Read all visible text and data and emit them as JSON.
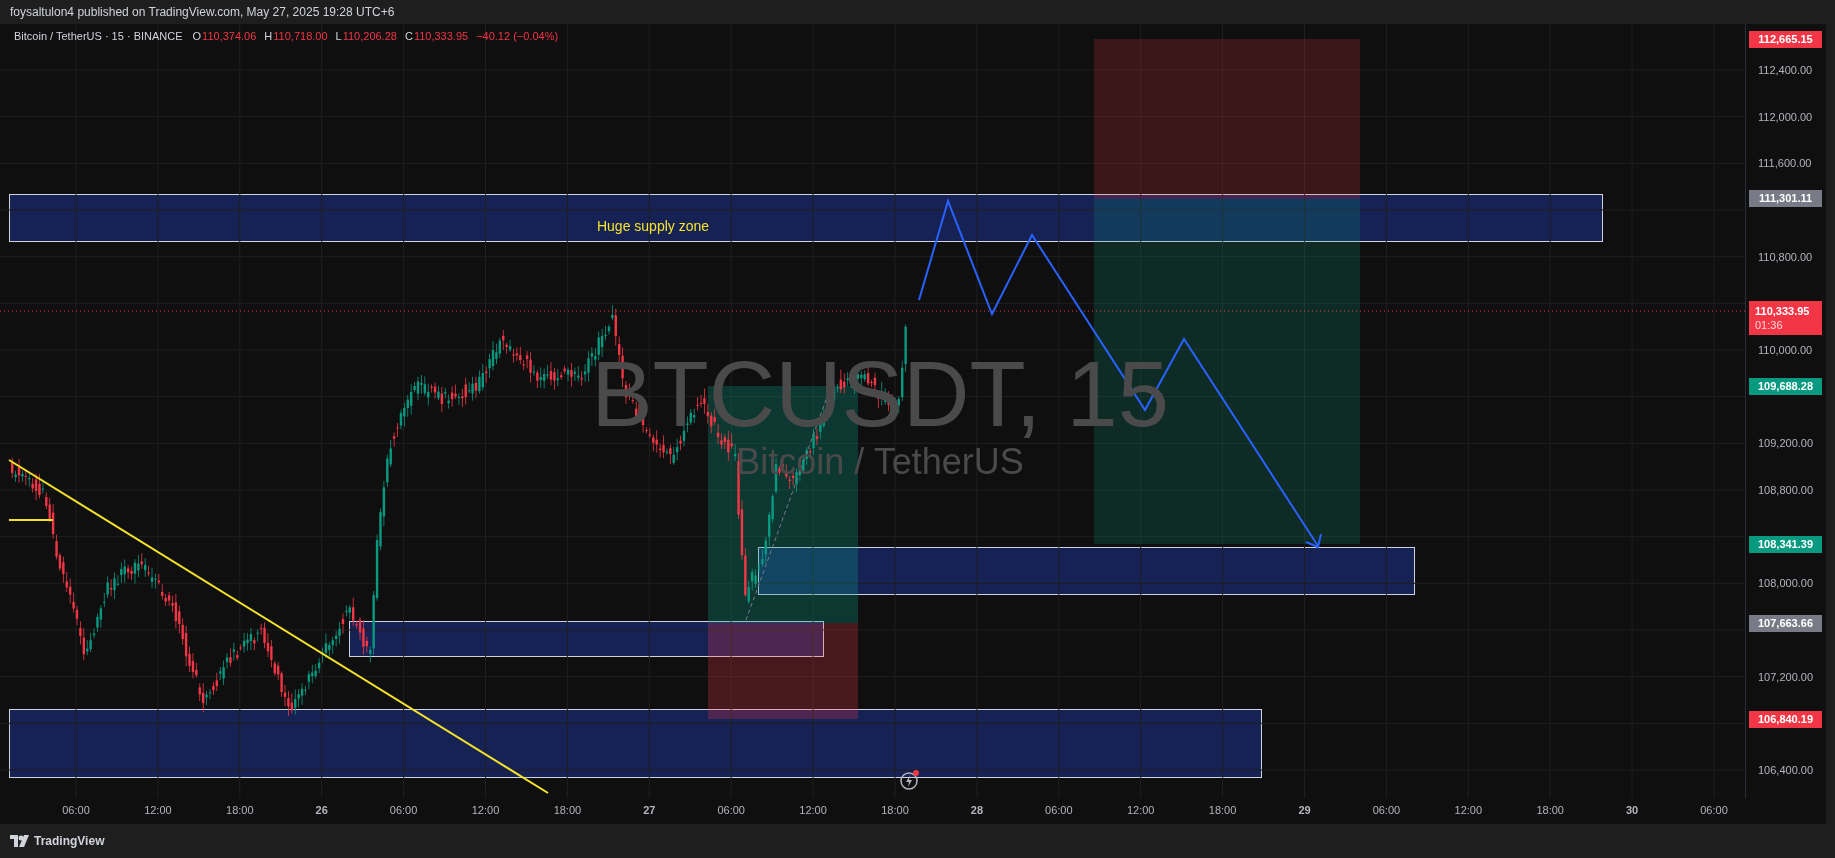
{
  "header": {
    "publisher": "foysaltulon4 published on TradingView.com, May 27, 2025 19:28 UTC+6"
  },
  "legend": {
    "symbol": "Bitcoin / TetherUS · 15 · BINANCE",
    "values": [
      {
        "label": "O",
        "value": "110,374.06"
      },
      {
        "label": "H",
        "value": "110,718.00"
      },
      {
        "label": "L",
        "value": "110,206.28"
      },
      {
        "label": "C",
        "value": "110,333.95"
      }
    ],
    "change": "−40.12 (−0.04%)"
  },
  "symbol_watermark": {
    "ticker": "BTCUSDT, 15",
    "name": "Bitcoin / TetherUS"
  },
  "annotation": {
    "text": "Huge supply zone"
  },
  "price_axis": {
    "ticks": [
      "112,400.00",
      "112,000.00",
      "111,600.00",
      "110,800.00",
      "110,000.00",
      "109,200.00",
      "108,800.00",
      "108,000.00",
      "107,200.00",
      "106,400.00"
    ],
    "labels": [
      {
        "text": "112,665.15",
        "kind": "stop"
      },
      {
        "text": "111,301.11",
        "kind": "entry"
      },
      {
        "text": "109,688.28",
        "kind": "target"
      },
      {
        "text": "108,341.39",
        "kind": "target"
      },
      {
        "text": "107,663.66",
        "kind": "entry"
      },
      {
        "text": "106,840.19",
        "kind": "stop"
      }
    ]
  },
  "current_price": {
    "price": "110,333.95",
    "countdown": "01:36"
  },
  "time_axis": {
    "labels": [
      {
        "text": "06:00",
        "kind": "time"
      },
      {
        "text": "12:00",
        "kind": "time"
      },
      {
        "text": "18:00",
        "kind": "time"
      },
      {
        "text": "26",
        "kind": "day"
      },
      {
        "text": "06:00",
        "kind": "time"
      },
      {
        "text": "12:00",
        "kind": "time"
      },
      {
        "text": "18:00",
        "kind": "time"
      },
      {
        "text": "27",
        "kind": "day"
      },
      {
        "text": "06:00",
        "kind": "time"
      },
      {
        "text": "12:00",
        "kind": "time"
      },
      {
        "text": "18:00",
        "kind": "time"
      },
      {
        "text": "28",
        "kind": "day"
      },
      {
        "text": "06:00",
        "kind": "time"
      },
      {
        "text": "12:00",
        "kind": "time"
      },
      {
        "text": "18:00",
        "kind": "time"
      },
      {
        "text": "29",
        "kind": "day"
      },
      {
        "text": "06:00",
        "kind": "time"
      },
      {
        "text": "12:00",
        "kind": "time"
      },
      {
        "text": "18:00",
        "kind": "time"
      },
      {
        "text": "30",
        "kind": "day"
      },
      {
        "text": "06:00",
        "kind": "time"
      }
    ]
  },
  "footer": {
    "brand": "TradingView"
  }
}
